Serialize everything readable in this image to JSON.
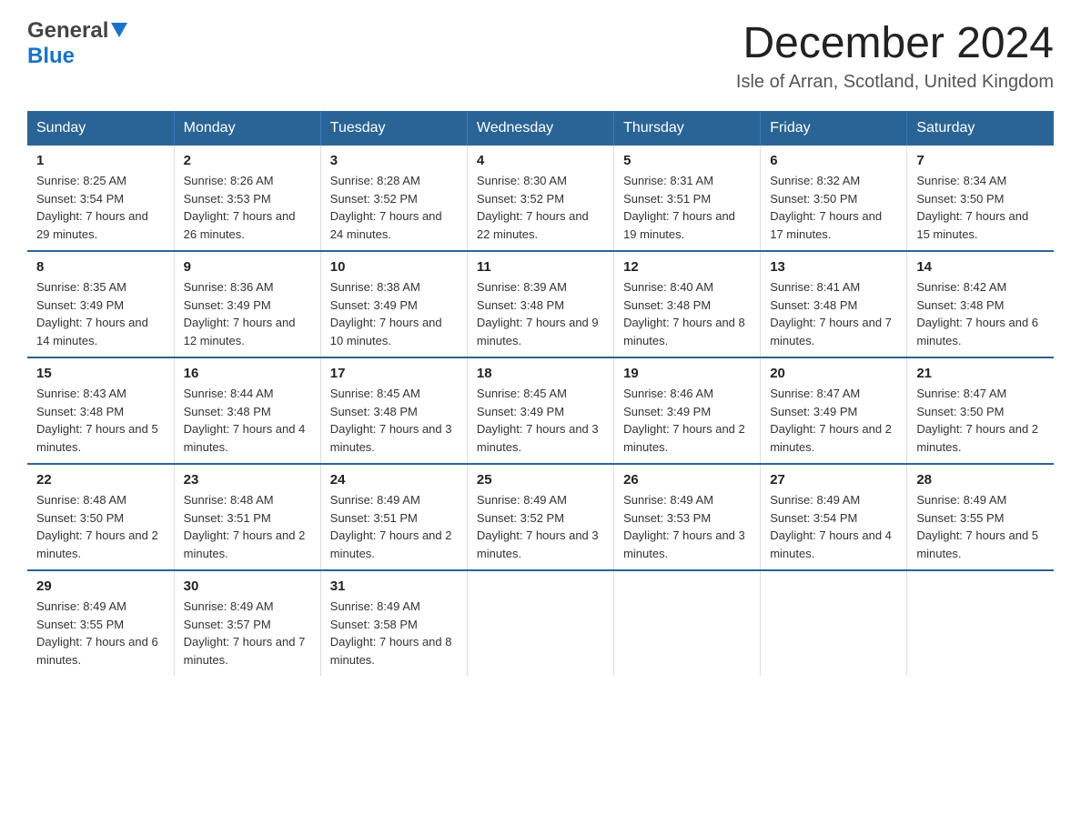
{
  "header": {
    "month_title": "December 2024",
    "location": "Isle of Arran, Scotland, United Kingdom",
    "logo_general": "General",
    "logo_blue": "Blue"
  },
  "days_of_week": [
    "Sunday",
    "Monday",
    "Tuesday",
    "Wednesday",
    "Thursday",
    "Friday",
    "Saturday"
  ],
  "weeks": [
    [
      {
        "day": "1",
        "sunrise": "8:25 AM",
        "sunset": "3:54 PM",
        "daylight": "7 hours and 29 minutes."
      },
      {
        "day": "2",
        "sunrise": "8:26 AM",
        "sunset": "3:53 PM",
        "daylight": "7 hours and 26 minutes."
      },
      {
        "day": "3",
        "sunrise": "8:28 AM",
        "sunset": "3:52 PM",
        "daylight": "7 hours and 24 minutes."
      },
      {
        "day": "4",
        "sunrise": "8:30 AM",
        "sunset": "3:52 PM",
        "daylight": "7 hours and 22 minutes."
      },
      {
        "day": "5",
        "sunrise": "8:31 AM",
        "sunset": "3:51 PM",
        "daylight": "7 hours and 19 minutes."
      },
      {
        "day": "6",
        "sunrise": "8:32 AM",
        "sunset": "3:50 PM",
        "daylight": "7 hours and 17 minutes."
      },
      {
        "day": "7",
        "sunrise": "8:34 AM",
        "sunset": "3:50 PM",
        "daylight": "7 hours and 15 minutes."
      }
    ],
    [
      {
        "day": "8",
        "sunrise": "8:35 AM",
        "sunset": "3:49 PM",
        "daylight": "7 hours and 14 minutes."
      },
      {
        "day": "9",
        "sunrise": "8:36 AM",
        "sunset": "3:49 PM",
        "daylight": "7 hours and 12 minutes."
      },
      {
        "day": "10",
        "sunrise": "8:38 AM",
        "sunset": "3:49 PM",
        "daylight": "7 hours and 10 minutes."
      },
      {
        "day": "11",
        "sunrise": "8:39 AM",
        "sunset": "3:48 PM",
        "daylight": "7 hours and 9 minutes."
      },
      {
        "day": "12",
        "sunrise": "8:40 AM",
        "sunset": "3:48 PM",
        "daylight": "7 hours and 8 minutes."
      },
      {
        "day": "13",
        "sunrise": "8:41 AM",
        "sunset": "3:48 PM",
        "daylight": "7 hours and 7 minutes."
      },
      {
        "day": "14",
        "sunrise": "8:42 AM",
        "sunset": "3:48 PM",
        "daylight": "7 hours and 6 minutes."
      }
    ],
    [
      {
        "day": "15",
        "sunrise": "8:43 AM",
        "sunset": "3:48 PM",
        "daylight": "7 hours and 5 minutes."
      },
      {
        "day": "16",
        "sunrise": "8:44 AM",
        "sunset": "3:48 PM",
        "daylight": "7 hours and 4 minutes."
      },
      {
        "day": "17",
        "sunrise": "8:45 AM",
        "sunset": "3:48 PM",
        "daylight": "7 hours and 3 minutes."
      },
      {
        "day": "18",
        "sunrise": "8:45 AM",
        "sunset": "3:49 PM",
        "daylight": "7 hours and 3 minutes."
      },
      {
        "day": "19",
        "sunrise": "8:46 AM",
        "sunset": "3:49 PM",
        "daylight": "7 hours and 2 minutes."
      },
      {
        "day": "20",
        "sunrise": "8:47 AM",
        "sunset": "3:49 PM",
        "daylight": "7 hours and 2 minutes."
      },
      {
        "day": "21",
        "sunrise": "8:47 AM",
        "sunset": "3:50 PM",
        "daylight": "7 hours and 2 minutes."
      }
    ],
    [
      {
        "day": "22",
        "sunrise": "8:48 AM",
        "sunset": "3:50 PM",
        "daylight": "7 hours and 2 minutes."
      },
      {
        "day": "23",
        "sunrise": "8:48 AM",
        "sunset": "3:51 PM",
        "daylight": "7 hours and 2 minutes."
      },
      {
        "day": "24",
        "sunrise": "8:49 AM",
        "sunset": "3:51 PM",
        "daylight": "7 hours and 2 minutes."
      },
      {
        "day": "25",
        "sunrise": "8:49 AM",
        "sunset": "3:52 PM",
        "daylight": "7 hours and 3 minutes."
      },
      {
        "day": "26",
        "sunrise": "8:49 AM",
        "sunset": "3:53 PM",
        "daylight": "7 hours and 3 minutes."
      },
      {
        "day": "27",
        "sunrise": "8:49 AM",
        "sunset": "3:54 PM",
        "daylight": "7 hours and 4 minutes."
      },
      {
        "day": "28",
        "sunrise": "8:49 AM",
        "sunset": "3:55 PM",
        "daylight": "7 hours and 5 minutes."
      }
    ],
    [
      {
        "day": "29",
        "sunrise": "8:49 AM",
        "sunset": "3:55 PM",
        "daylight": "7 hours and 6 minutes."
      },
      {
        "day": "30",
        "sunrise": "8:49 AM",
        "sunset": "3:57 PM",
        "daylight": "7 hours and 7 minutes."
      },
      {
        "day": "31",
        "sunrise": "8:49 AM",
        "sunset": "3:58 PM",
        "daylight": "7 hours and 8 minutes."
      },
      null,
      null,
      null,
      null
    ]
  ]
}
